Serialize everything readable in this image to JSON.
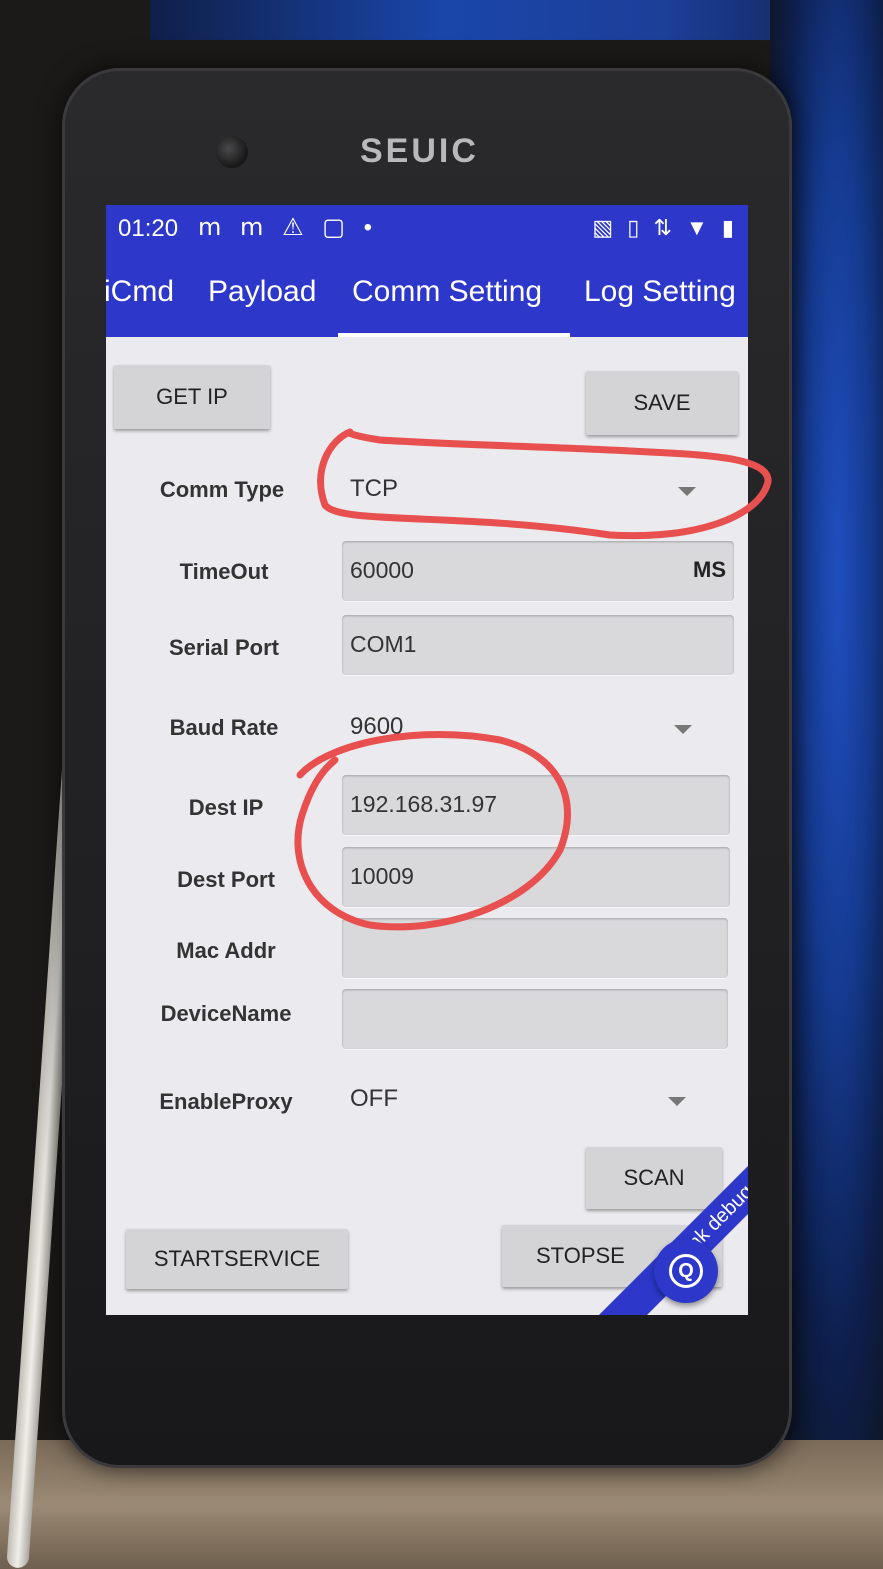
{
  "device": {
    "brand": "SEUIC"
  },
  "status_bar": {
    "time": "01:20",
    "left_icons": "ⅿ ⅿ ⚠ ▢ •",
    "right_icons": "▧ ▯ ⇅ ▼ ▮"
  },
  "tabs": [
    {
      "label": "iCmd"
    },
    {
      "label": "Payload"
    },
    {
      "label": "Comm Setting",
      "selected": true
    },
    {
      "label": "Log Setting"
    }
  ],
  "buttons": {
    "get_ip": "GET IP",
    "save": "SAVE",
    "scan": "SCAN",
    "start_service": "STARTSERVICE",
    "stop_service": "STOPSE"
  },
  "form": {
    "comm_type": {
      "label": "Comm Type",
      "value": "TCP"
    },
    "timeout": {
      "label": "TimeOut",
      "value": "60000",
      "unit": "MS"
    },
    "serial_port": {
      "label": "Serial Port",
      "value": "COM1"
    },
    "baud_rate": {
      "label": "Baud Rate",
      "value": "9600"
    },
    "dest_ip": {
      "label": "Dest IP",
      "value": "192.168.31.97"
    },
    "dest_port": {
      "label": "Dest Port",
      "value": "10009"
    },
    "mac_addr": {
      "label": "Mac Addr",
      "value": ""
    },
    "device_name": {
      "label": "DeviceName",
      "value": ""
    },
    "enable_proxy": {
      "label": "EnableProxy",
      "value": "OFF"
    }
  },
  "debug_banner": "poslink debug",
  "fab": {
    "glyph": "Q"
  },
  "colors": {
    "app_bar": "#2d37c9",
    "screen_bg": "#ebebef",
    "field_bg": "#d9d9dc",
    "annotation": "#e8504f"
  }
}
